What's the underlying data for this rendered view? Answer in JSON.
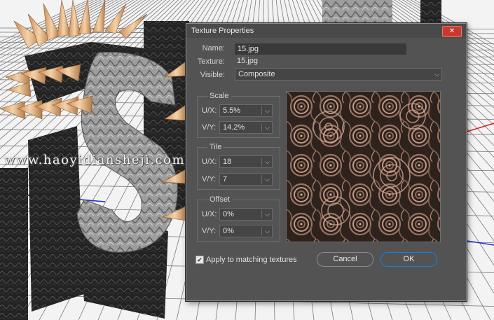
{
  "watermark": "www.haoyidiansheji.com",
  "dialog": {
    "title": "Texture Properties",
    "close_glyph": "✕",
    "name_label": "Name:",
    "name_value": "15.jpg",
    "texture_label": "Texture:",
    "texture_value": "15.jpg",
    "visible_label": "Visible:",
    "visible_value": "Composite",
    "scale": {
      "title": "Scale",
      "ux_label": "U/X:",
      "ux_value": "5.5%",
      "vy_label": "V/Y:",
      "vy_value": "14.2%"
    },
    "tile": {
      "title": "Tile",
      "ux_label": "U/X:",
      "ux_value": "18",
      "vy_label": "V/Y:",
      "vy_value": "7"
    },
    "offset": {
      "title": "Offset",
      "ux_label": "U/X:",
      "ux_value": "0%",
      "vy_label": "V/Y:",
      "vy_value": "0%"
    },
    "apply_checked": true,
    "apply_label": "Apply to matching textures",
    "cancel_label": "Cancel",
    "ok_label": "OK",
    "check_glyph": "✔"
  },
  "icons": {
    "close": "close-icon",
    "dropdown": "chevron-down-icon",
    "check": "checkmark-icon"
  },
  "colors": {
    "dialog_bg": "#535353",
    "close_red": "#c9392e",
    "ok_border": "#3c74b8",
    "axis_red": "#e02020",
    "axis_blue": "#2030d0"
  }
}
